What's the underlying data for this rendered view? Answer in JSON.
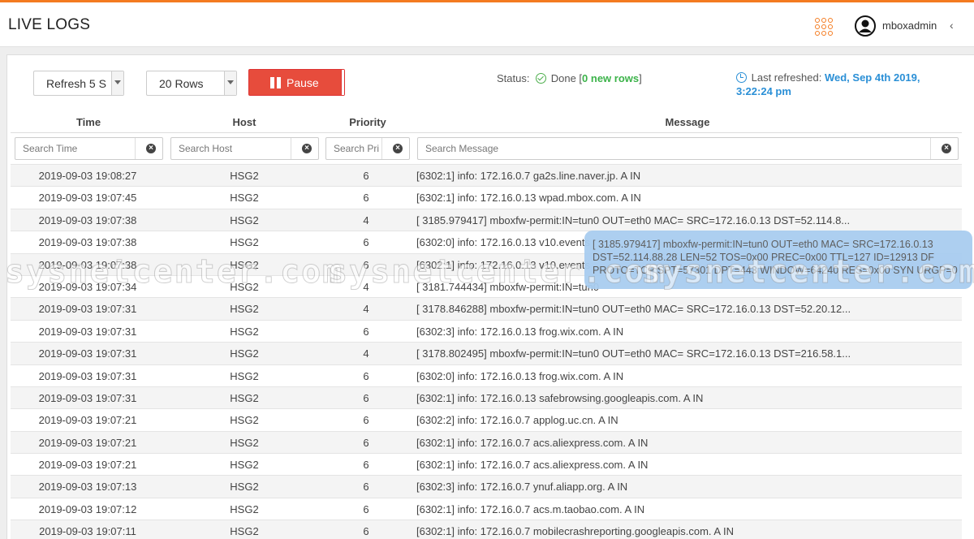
{
  "header": {
    "title": "LIVE LOGS",
    "username": "mboxadmin",
    "chevron": "‹",
    "icons": {
      "apps": "apps-grid-icon",
      "avatar": "user-avatar-icon"
    },
    "accent_color": "#f47b20"
  },
  "controls": {
    "refresh_select": "Refresh 5 S",
    "rows_select": "20 Rows",
    "pause_label": "Pause",
    "pause_color": "#e74c3c",
    "status_label": "Status:",
    "status_value": "Done",
    "status_bracket_open": "[",
    "status_new_rows": "0 new rows",
    "status_bracket_close": "]",
    "last_refreshed_label": "Last refreshed:",
    "last_refreshed_value": "Wed, Sep 4th 2019, 3:22:24 pm"
  },
  "table": {
    "columns": [
      "Time",
      "Host",
      "Priority",
      "Message"
    ],
    "filters": {
      "time_placeholder": "Search Time",
      "host_placeholder": "Search Host",
      "priority_placeholder": "Search Pri",
      "message_placeholder": "Search Message"
    },
    "rows": [
      {
        "time": "2019-09-03 19:08:27",
        "host": "HSG2",
        "priority": "6",
        "message": "[6302:1] info: 172.16.0.7 ga2s.line.naver.jp. A IN"
      },
      {
        "time": "2019-09-03 19:07:45",
        "host": "HSG2",
        "priority": "6",
        "message": "[6302:1] info: 172.16.0.13 wpad.mbox.com. A IN"
      },
      {
        "time": "2019-09-03 19:07:38",
        "host": "HSG2",
        "priority": "4",
        "message": "[ 3185.979417] mboxfw-permit:IN=tun0 OUT=eth0 MAC= SRC=172.16.0.13 DST=52.114.8..."
      },
      {
        "time": "2019-09-03 19:07:38",
        "host": "HSG2",
        "priority": "6",
        "message": "[6302:0] info: 172.16.0.13 v10.events"
      },
      {
        "time": "2019-09-03 19:07:38",
        "host": "HSG2",
        "priority": "6",
        "message": "[6302:1] info: 172.16.0.13 v10.events"
      },
      {
        "time": "2019-09-03 19:07:34",
        "host": "HSG2",
        "priority": "4",
        "message": "[ 3181.744434] mboxfw-permit:IN=tun0"
      },
      {
        "time": "2019-09-03 19:07:31",
        "host": "HSG2",
        "priority": "4",
        "message": "[ 3178.846288] mboxfw-permit:IN=tun0 OUT=eth0 MAC= SRC=172.16.0.13 DST=52.20.12..."
      },
      {
        "time": "2019-09-03 19:07:31",
        "host": "HSG2",
        "priority": "6",
        "message": "[6302:3] info: 172.16.0.13 frog.wix.com. A IN"
      },
      {
        "time": "2019-09-03 19:07:31",
        "host": "HSG2",
        "priority": "4",
        "message": "[ 3178.802495] mboxfw-permit:IN=tun0 OUT=eth0 MAC= SRC=172.16.0.13 DST=216.58.1..."
      },
      {
        "time": "2019-09-03 19:07:31",
        "host": "HSG2",
        "priority": "6",
        "message": "[6302:0] info: 172.16.0.13 frog.wix.com. A IN"
      },
      {
        "time": "2019-09-03 19:07:31",
        "host": "HSG2",
        "priority": "6",
        "message": "[6302:1] info: 172.16.0.13 safebrowsing.googleapis.com. A IN"
      },
      {
        "time": "2019-09-03 19:07:21",
        "host": "HSG2",
        "priority": "6",
        "message": "[6302:2] info: 172.16.0.7 applog.uc.cn. A IN"
      },
      {
        "time": "2019-09-03 19:07:21",
        "host": "HSG2",
        "priority": "6",
        "message": "[6302:1] info: 172.16.0.7 acs.aliexpress.com. A IN"
      },
      {
        "time": "2019-09-03 19:07:21",
        "host": "HSG2",
        "priority": "6",
        "message": "[6302:1] info: 172.16.0.7 acs.aliexpress.com. A IN"
      },
      {
        "time": "2019-09-03 19:07:13",
        "host": "HSG2",
        "priority": "6",
        "message": "[6302:3] info: 172.16.0.7 ynuf.aliapp.org. A IN"
      },
      {
        "time": "2019-09-03 19:07:12",
        "host": "HSG2",
        "priority": "6",
        "message": "[6302:1] info: 172.16.0.7 acs.m.taobao.com. A IN"
      },
      {
        "time": "2019-09-03 19:07:11",
        "host": "HSG2",
        "priority": "6",
        "message": "[6302:1] info: 172.16.0.7 mobilecrashreporting.googleapis.com. A IN"
      }
    ]
  },
  "tooltip": {
    "text": "[ 3185.979417] mboxfw-permit:IN=tun0 OUT=eth0 MAC= SRC=172.16.0.13 DST=52.114.88.28 LEN=52 TOS=0x00 PREC=0x00 TTL=127 ID=12913 DF PROTO=TCP SPT=57301 DPT=443 WINDOW=64240 RES=0x00 SYN URGP=0"
  },
  "watermark": {
    "text_left": "sysnetcenter.com",
    "text_mid": "sysnetcenter.com",
    "text_right": "sysnetcenter.com"
  }
}
